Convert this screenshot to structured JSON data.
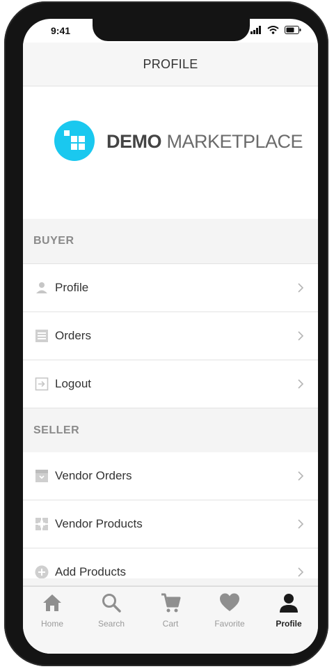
{
  "status_bar": {
    "time": "9:41"
  },
  "header": {
    "title": "PROFILE"
  },
  "logo": {
    "word_strong": "DEMO",
    "word_light": "MARKETPLACE",
    "accent": "#1ac8ef"
  },
  "sections": [
    {
      "title": "BUYER",
      "items": [
        {
          "label": "Profile",
          "icon": "person-icon"
        },
        {
          "label": "Orders",
          "icon": "list-icon"
        },
        {
          "label": "Logout",
          "icon": "logout-icon"
        }
      ]
    },
    {
      "title": "SELLER",
      "items": [
        {
          "label": "Vendor Orders",
          "icon": "box-icon"
        },
        {
          "label": "Vendor Products",
          "icon": "products-icon"
        },
        {
          "label": "Add Products",
          "icon": "add-circle-icon"
        }
      ]
    }
  ],
  "tabs": [
    {
      "label": "Home",
      "icon": "home-icon",
      "active": false
    },
    {
      "label": "Search",
      "icon": "search-icon",
      "active": false
    },
    {
      "label": "Cart",
      "icon": "cart-icon",
      "active": false
    },
    {
      "label": "Favorite",
      "icon": "heart-icon",
      "active": false
    },
    {
      "label": "Profile",
      "icon": "person-icon",
      "active": true
    }
  ],
  "colors": {
    "inactive_tab": "#8f8f8f",
    "active_tab": "#1a1a1a",
    "row_icon": "#bdbdbd"
  }
}
